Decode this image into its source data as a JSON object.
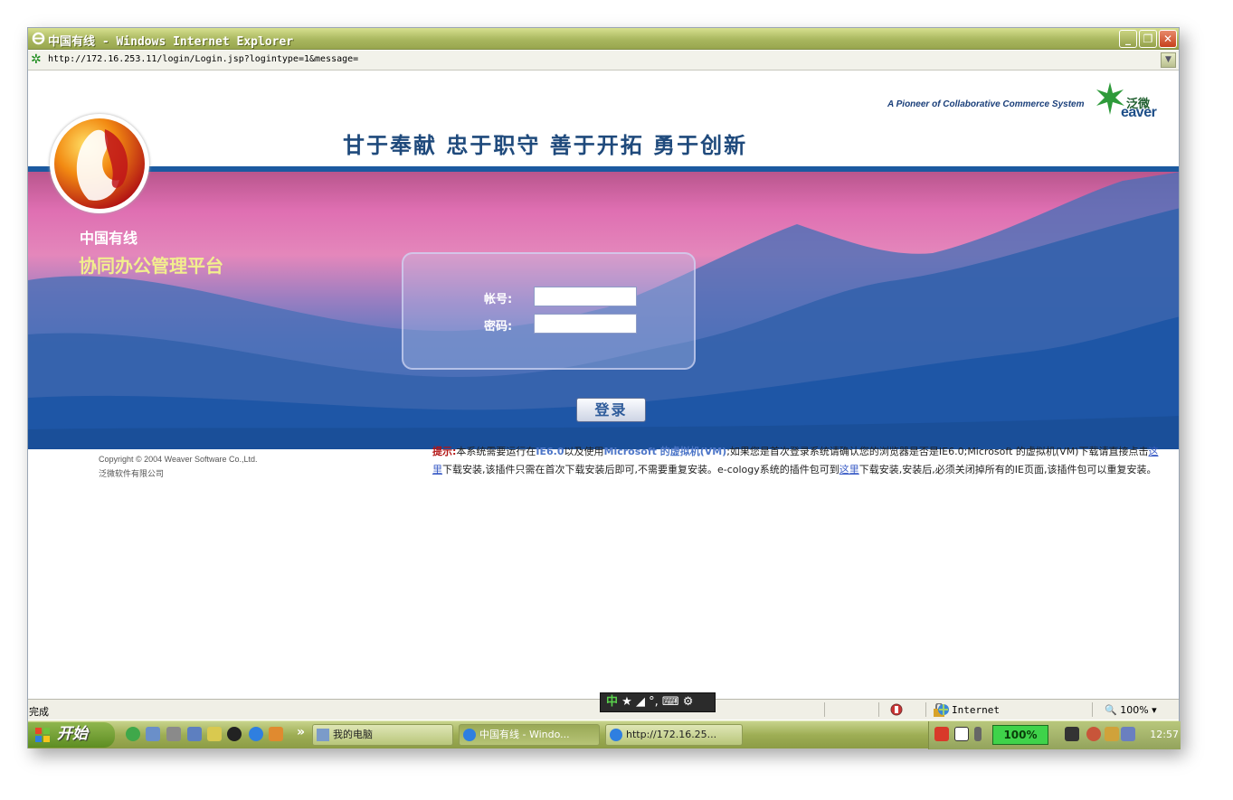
{
  "window": {
    "title": "中国有线 - Windows Internet Explorer",
    "minimize": "_",
    "restore": "❐",
    "close": "✕"
  },
  "address": {
    "url": "http://172.16.253.11/login/Login.jsp?logintype=1&message="
  },
  "header": {
    "tagline": "A Pioneer of Collaborative Commerce System",
    "brand_cn": "泛微",
    "brand_en": "eaver",
    "motto": "甘于奉献 忠于职守 善于开拓 勇于创新"
  },
  "banner": {
    "org_name": "中国有线",
    "platform_name": "协同办公管理平台"
  },
  "login": {
    "account_label": "帐号:",
    "password_label": "密码:",
    "account_value": "",
    "password_value": "",
    "submit_label": "登录"
  },
  "footer": {
    "copyright": "Copyright © 2004 Weaver Software Co.,Ltd.",
    "company": "泛微软件有限公司"
  },
  "notice": {
    "heading": "提示:",
    "t1": "本系统需要运行在",
    "ie": "IE6.0",
    "t2": "以及使用",
    "vm": "Microsoft 的虚拟机(VM)",
    "t3": ";如果您是首次登录系统请确认您的浏览器是否是IE6.0;Microsoft 的虚拟机(VM)下载请直接点击",
    "link1": "这里",
    "t4": "下载安装,该插件只需在首次下载安装后即可,不需要重复安装。e-cology系统的插件包可到",
    "link2": "这里",
    "t5": "下载安装,安装后,必须关闭掉所有的IE页面,该插件包可以重复安装。"
  },
  "statusbar": {
    "status": "完成",
    "zone": "Internet",
    "zoom": "100%"
  },
  "ime": {
    "mode": "中",
    "symbols": "★ ◢ °, ⌨ ⚙"
  },
  "taskbar": {
    "start": "开始",
    "more": "»",
    "tasks": [
      "我的电脑",
      "中国有线 - Windo...",
      "http://172.16.25..."
    ],
    "battery": "100%",
    "clock": "12:57"
  },
  "colors": {
    "motto": "#1f4a7c",
    "stripe": "#1b5aa0",
    "notice_heading": "#b21414",
    "platform_name": "#f2ee8e"
  }
}
